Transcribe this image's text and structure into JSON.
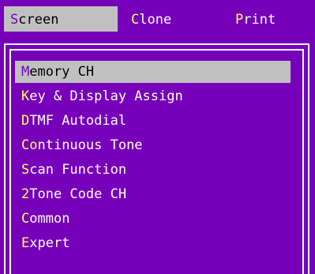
{
  "menubar": {
    "tabs": [
      {
        "hotkey": "S",
        "rest": "creen",
        "active": true
      },
      {
        "hotkey": "C",
        "rest": "lone",
        "active": false
      },
      {
        "hotkey": "P",
        "rest": "rint",
        "active": false
      }
    ]
  },
  "menu": {
    "items": [
      {
        "hotkey": "M",
        "rest": "emory CH",
        "selected": true
      },
      {
        "hotkey": "K",
        "rest": "ey & Display Assign",
        "selected": false
      },
      {
        "hotkey": "D",
        "rest": "TMF Autodial",
        "selected": false
      },
      {
        "hotkey": "Co",
        "rest": "ntinuous Tone",
        "selected": false
      },
      {
        "hotkey": "S",
        "rest": "can Function",
        "selected": false
      },
      {
        "hotkey": "2",
        "rest": "Tone Code CH",
        "selected": false
      },
      {
        "hotkey": "C",
        "rest": "ommon",
        "selected": false
      },
      {
        "hotkey": "E",
        "rest": "xpert",
        "selected": false
      }
    ]
  },
  "colors": {
    "background": "#7700bb",
    "text": "#ffffff",
    "hotkey": "#ffff55",
    "highlight": "#c0c0c0"
  }
}
